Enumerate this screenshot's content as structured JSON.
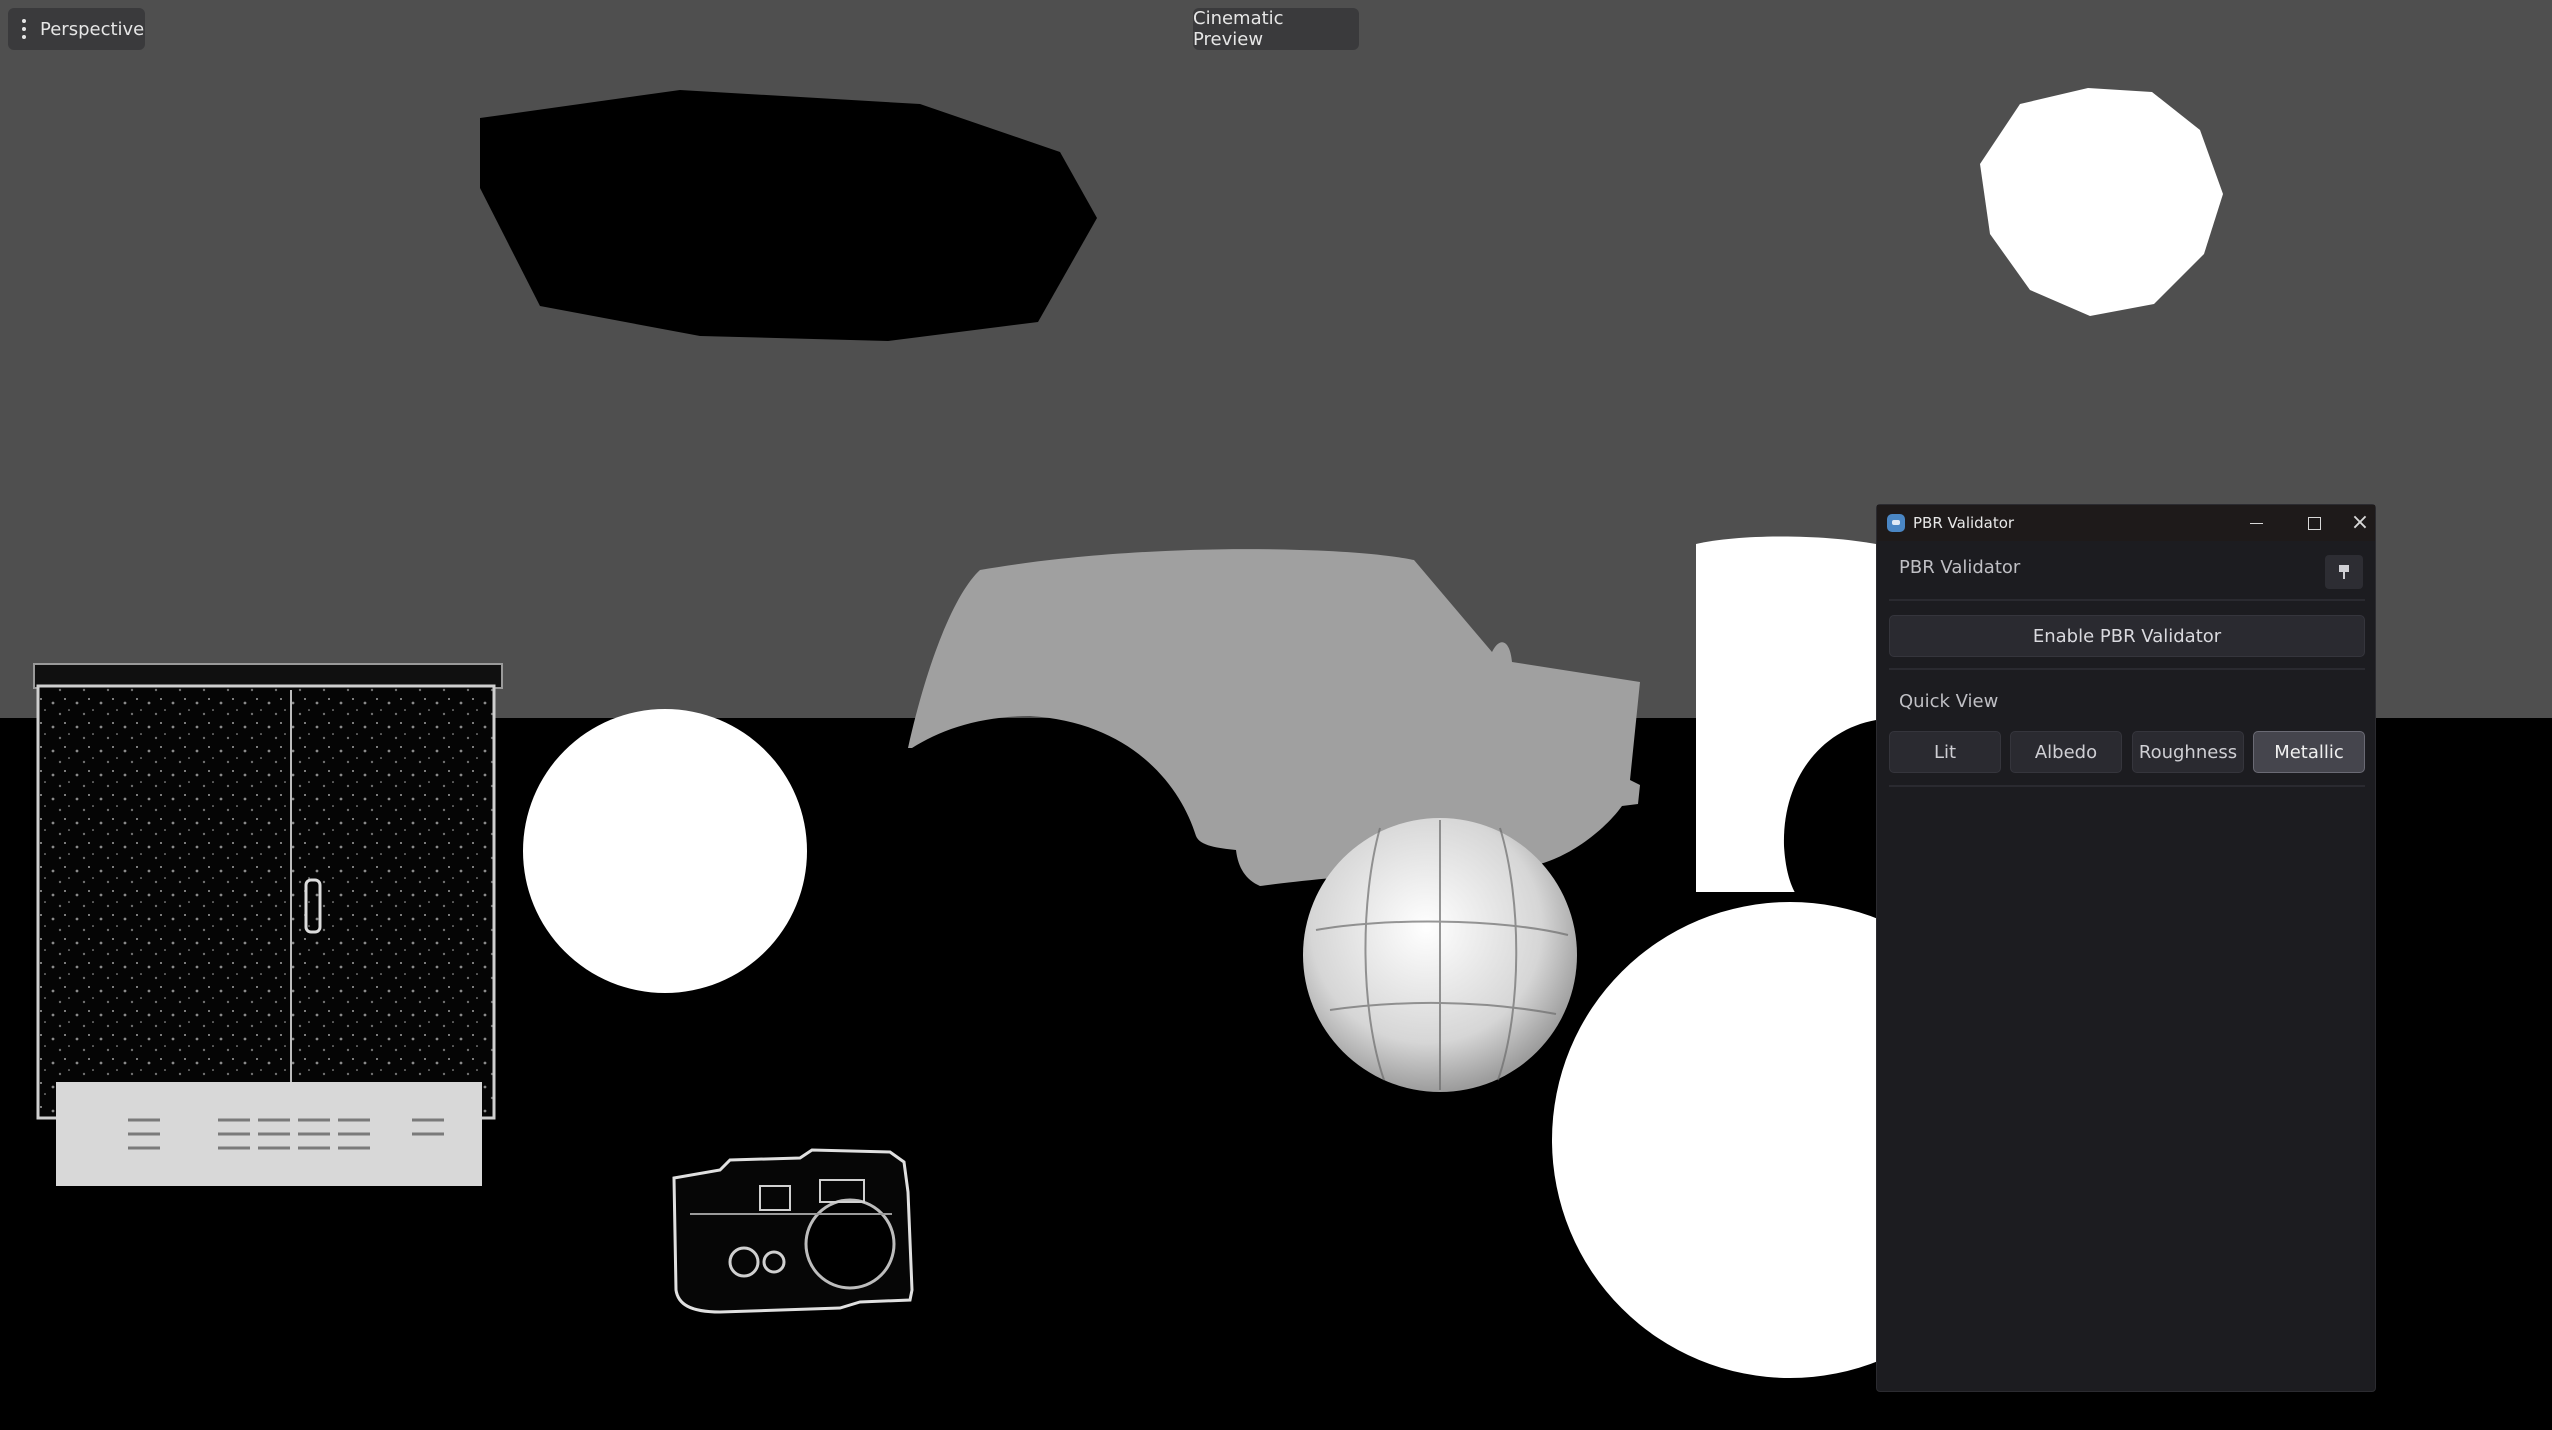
{
  "viewport": {
    "view_mode_label": "Perspective",
    "cinematic_label": "Cinematic Preview"
  },
  "window": {
    "title": "PBR Validator",
    "panel_title": "PBR Validator",
    "enable_label": "Enable PBR Validator",
    "quick_view_label": "Quick View",
    "quick_view_options": [
      "Lit",
      "Albedo",
      "Roughness",
      "Metallic"
    ],
    "quick_view_selected": "Metallic"
  },
  "colors": {
    "sky": "#4f4f4f",
    "floor": "#000000",
    "panel_bg": "#1c1c20",
    "vehicle": "#a0a0a0"
  }
}
